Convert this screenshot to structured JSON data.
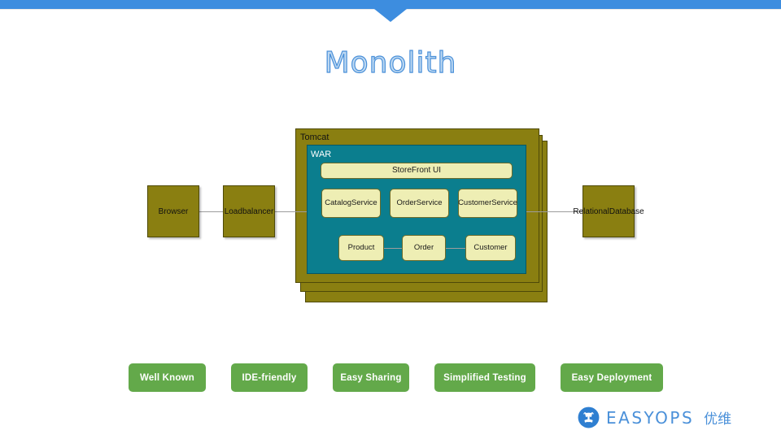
{
  "slide": {
    "title": "Monolith",
    "accent_blue": "#3d8ddf",
    "title_color": "#bed9f2",
    "olive": "#8a7f11",
    "teal": "#0b7e8e",
    "pale_yellow": "#eeeeb4",
    "pill_green": "#63a94a"
  },
  "diagram": {
    "tomcat_label": "Tomcat",
    "war_label": "WAR",
    "storefront_ui": "StoreFront UI",
    "services": [
      {
        "label": "Catalog\nService",
        "line1": "Catalog",
        "line2": "Service"
      },
      {
        "label": "Order\nService",
        "line1": "Order",
        "line2": "Service"
      },
      {
        "label": "Customer\nService",
        "line1": "Customer",
        "line2": "Service"
      }
    ],
    "entities": [
      {
        "label": "Product"
      },
      {
        "label": "Order"
      },
      {
        "label": "Customer"
      }
    ],
    "external": {
      "browser": "Browser",
      "load_balancer_line1": "Load",
      "load_balancer_line2": "balancer",
      "database_line1": "Relational",
      "database_line2": "Database"
    }
  },
  "benefits": [
    {
      "label": "Well Known"
    },
    {
      "label": "IDE-friendly"
    },
    {
      "label": "Easy Sharing"
    },
    {
      "label": "Simplified  Testing"
    },
    {
      "label": "Easy Deployment"
    }
  ],
  "logo": {
    "wordmark": "EASYOPS",
    "chinese": "优维",
    "icon": "easyops-giraffe-icon",
    "color": "#4a90d9"
  }
}
